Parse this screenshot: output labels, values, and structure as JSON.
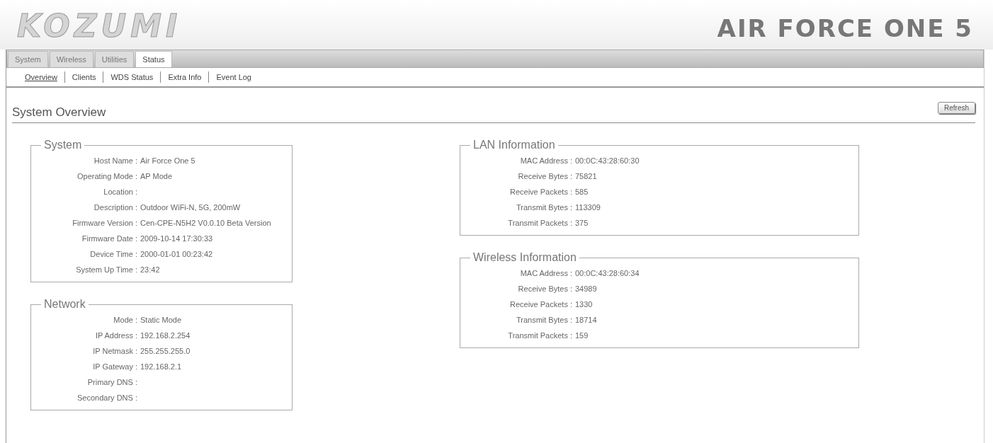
{
  "header": {
    "logo": "KOZUMI",
    "product": "AIR FORCE ONE 5"
  },
  "tabs": [
    {
      "label": "System",
      "selected": false
    },
    {
      "label": "Wireless",
      "selected": false
    },
    {
      "label": "Utilities",
      "selected": false
    },
    {
      "label": "Status",
      "selected": true
    }
  ],
  "subtabs": [
    {
      "label": "Overview",
      "selected": true
    },
    {
      "label": "Clients",
      "selected": false
    },
    {
      "label": "WDS Status",
      "selected": false
    },
    {
      "label": "Extra Info",
      "selected": false
    },
    {
      "label": "Event Log",
      "selected": false
    }
  ],
  "page_title": "System Overview",
  "refresh_button": "Refresh",
  "columns": [
    [
      {
        "title": "System",
        "rows": [
          {
            "label": "Host Name :",
            "value": "Air Force One 5"
          },
          {
            "label": "Operating Mode :",
            "value": "AP Mode"
          },
          {
            "label": "Location :"
          },
          {
            "label": "Description :",
            "value": "Outdoor WiFi-N, 5G, 200mW"
          },
          {
            "label": "Firmware Version :",
            "value": "Cen-CPE-N5H2 V0.0.10 Beta Version"
          },
          {
            "label": "Firmware Date :",
            "value": "2009-10-14 17:30:33"
          },
          {
            "label": "Device Time :",
            "value": "2000-01-01 00:23:42"
          },
          {
            "label": "System Up Time :",
            "value": "23:42"
          }
        ]
      },
      {
        "title": "Network",
        "rows": [
          {
            "label": "Mode :",
            "value": "Static Mode"
          },
          {
            "label": "IP Address :",
            "value": "192.168.2.254"
          },
          {
            "label": "IP Netmask :",
            "value": "255.255.255.0"
          },
          {
            "label": "IP Gateway :",
            "value": "192.168.2.1"
          },
          {
            "label": "Primary DNS :"
          },
          {
            "label": "Secondary DNS :"
          }
        ]
      }
    ],
    [
      {
        "title": "LAN Information",
        "rows": [
          {
            "label": "MAC Address :",
            "value": "00:0C:43:28:60:30"
          },
          {
            "label": "Receive Bytes :",
            "value": "75821"
          },
          {
            "label": "Receive Packets :",
            "value": "585"
          },
          {
            "label": "Transmit Bytes :",
            "value": "113309"
          },
          {
            "label": "Transmit Packets :",
            "value": "375"
          }
        ]
      },
      {
        "title": "Wireless Information",
        "rows": [
          {
            "label": "MAC Address :",
            "value": "00:0C:43:28:60:34"
          },
          {
            "label": "Receive Bytes :",
            "value": "34989"
          },
          {
            "label": "Receive Packets :",
            "value": "1330"
          },
          {
            "label": "Transmit Bytes :",
            "value": "18714"
          },
          {
            "label": "Transmit Packets :",
            "value": "159"
          }
        ]
      }
    ]
  ]
}
